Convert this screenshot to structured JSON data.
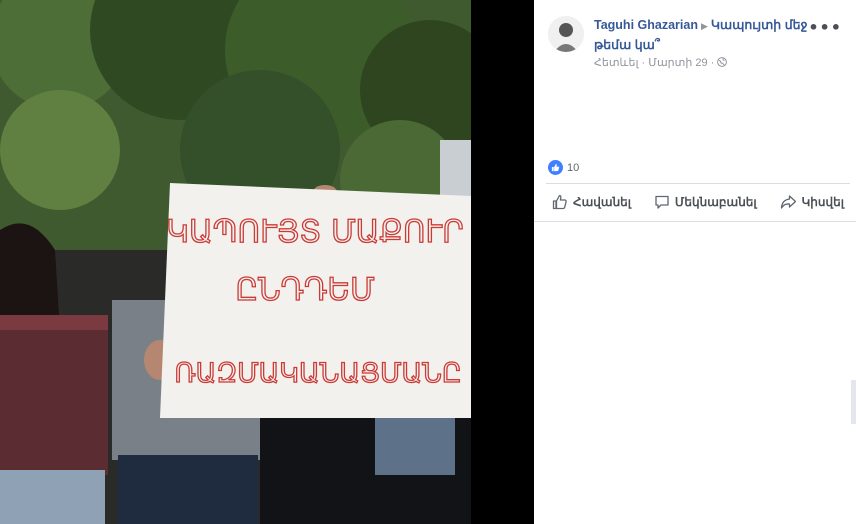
{
  "post": {
    "author": "Taguhi Ghazarian",
    "group": "Կապույտի մեջ թեմա կա՞",
    "follow_label": "Հետևել",
    "date": "Մարտի 29",
    "separator": "·",
    "more_label": "•••"
  },
  "reactions": {
    "count": "10"
  },
  "actions": {
    "like_label": "Հավանել",
    "comment_label": "Մեկնաբանել",
    "share_label": "Կիսվել"
  },
  "photo": {
    "sign_lines": [
      "ԿԱՊՈՒՅՏ ՄԱՔՈՒՐ",
      "ԸՆԴԴԵՄ",
      "ՌԱԶՄԱԿԱՆԱՑՄԱՆԸ"
    ]
  },
  "colors": {
    "link": "#365899",
    "like_blue": "#4080ff",
    "sign_text": "#cc3a36"
  }
}
